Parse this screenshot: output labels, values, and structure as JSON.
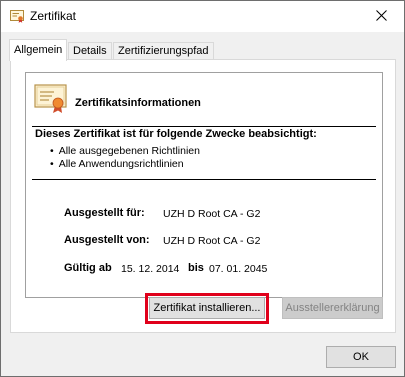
{
  "window": {
    "title": "Zertifikat"
  },
  "tabs": [
    {
      "label": "Allgemein",
      "active": true
    },
    {
      "label": "Details",
      "active": false
    },
    {
      "label": "Zertifizierungspfad",
      "active": false
    }
  ],
  "info": {
    "title": "Zertifikatsinformationen",
    "purpose_heading": "Dieses Zertifikat ist für folgende Zwecke beabsichtigt:",
    "purposes": [
      "Alle ausgegebenen Richtlinien",
      "Alle Anwendungsrichtlinien"
    ],
    "issued_to_label": "Ausgestellt für:",
    "issued_to_value": "UZH D Root CA - G2",
    "issued_by_label": "Ausgestellt von:",
    "issued_by_value": "UZH D Root CA - G2",
    "valid_from_label": "Gültig ab",
    "valid_from_value": "15. 12. 2014",
    "valid_to_label": "bis",
    "valid_to_value": "07. 01. 2045"
  },
  "buttons": {
    "install": "Zertifikat installieren...",
    "issuer_statement": "Ausstellererklärung",
    "ok": "OK"
  },
  "colors": {
    "highlight": "#e0001b",
    "window_bg": "#f0f0f0"
  },
  "icons": [
    "certificate-icon",
    "close-icon"
  ]
}
